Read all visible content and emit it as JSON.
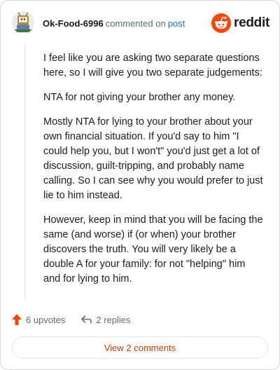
{
  "header": {
    "username": "Ok-Food-6996",
    "verb": "commented on",
    "post_link": "post",
    "logo_text": "reddit"
  },
  "comment": {
    "paragraphs": [
      "I feel like you are asking two separate questions here, so I will give you two separate judgements:",
      "NTA for not giving your brother any money.",
      "Mostly NTA for lying to your brother about your own financial situation. If you'd say to him \"I could help you, but I won't\" you'd just get a lot of discussion, guilt-tripping, and probably name calling. So I can see why you would prefer to just lie to him instead.",
      "However, keep in mind that you will be facing the same (and worse) if (or when) your brother discovers the truth. You will very likely be a double A for your family: for not \"helping\" him and for lying to him."
    ]
  },
  "footer": {
    "upvotes": "6 upvotes",
    "replies": "2 replies"
  },
  "view_button": "View 2 comments",
  "colors": {
    "accent": "#d93a00",
    "upvote": "#ff4500",
    "link": "#0079d3"
  },
  "icons": {
    "avatar": "avatar-icon",
    "logo": "reddit-logo-icon",
    "upvote": "upvote-arrow-icon",
    "reply": "reply-arrow-icon"
  }
}
